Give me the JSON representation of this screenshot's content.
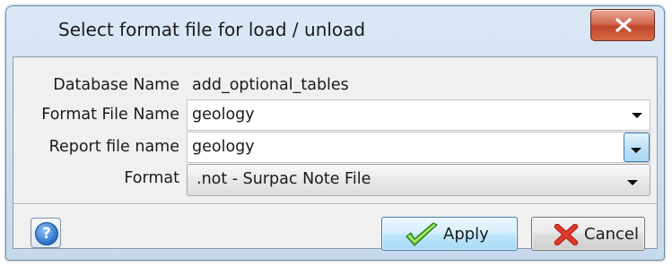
{
  "window": {
    "title": "Select format file for load / unload",
    "close_glyph": "x"
  },
  "form": {
    "database_name": {
      "label": "Database Name",
      "value": "add_optional_tables"
    },
    "format_file_name": {
      "label": "Format File Name",
      "value": "geology"
    },
    "report_file_name": {
      "label": "Report file name",
      "value": "geology"
    },
    "format": {
      "label": "Format",
      "value": ".not - Surpac Note File"
    }
  },
  "buttons": {
    "help_glyph": "?",
    "apply_label": "Apply",
    "cancel_label": "Cancel"
  },
  "icons": {
    "close": "close-icon",
    "help": "help-icon",
    "apply": "checkmark-icon",
    "cancel": "cross-icon"
  },
  "colors": {
    "close_button": "#c94b31",
    "apply_check": "#5fb32e",
    "cancel_cross": "#d8352a",
    "help_icon": "#2a6fc9"
  }
}
